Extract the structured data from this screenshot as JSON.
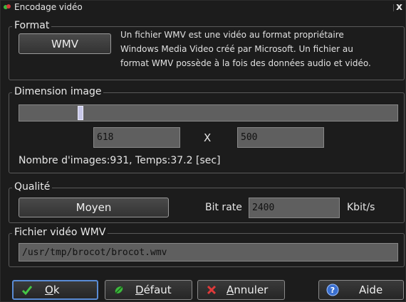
{
  "window": {
    "title": "Encodage vidéo",
    "close_glyph": "x"
  },
  "format": {
    "label": "Format",
    "button": "WMV",
    "description": [
      "Un fichier WMV est une vidéo au format propriétaire",
      "Windows Media Video créé par Microsoft. Un fichier au",
      "format WMV possède à la fois des données audio et vidéo."
    ]
  },
  "dimension": {
    "label": "Dimension image",
    "slider_value_fraction": 0.157,
    "width": "618",
    "separator": "X",
    "height": "500",
    "info": "Nombre d'images:931, Temps:37.2 [sec]"
  },
  "quality": {
    "label": "Qualité",
    "button": "Moyen",
    "bitrate_label": "Bit rate",
    "bitrate_value": "2400",
    "bitrate_unit": "Kbit/s"
  },
  "file": {
    "label": "Fichier vidéo WMV",
    "path": "/usr/tmp/brocot/brocot.wmv"
  },
  "buttons": {
    "ok": "Ok",
    "default": "Défaut",
    "cancel": "Annuler",
    "help": "Aide"
  },
  "icons": {
    "title": "app-icon",
    "ok": "check-icon",
    "default": "leaf-icon",
    "cancel": "cross-icon",
    "help": "help-icon"
  },
  "colors": {
    "accent_border": "#5a8cd6",
    "field_bg": "#5f5f5f"
  }
}
